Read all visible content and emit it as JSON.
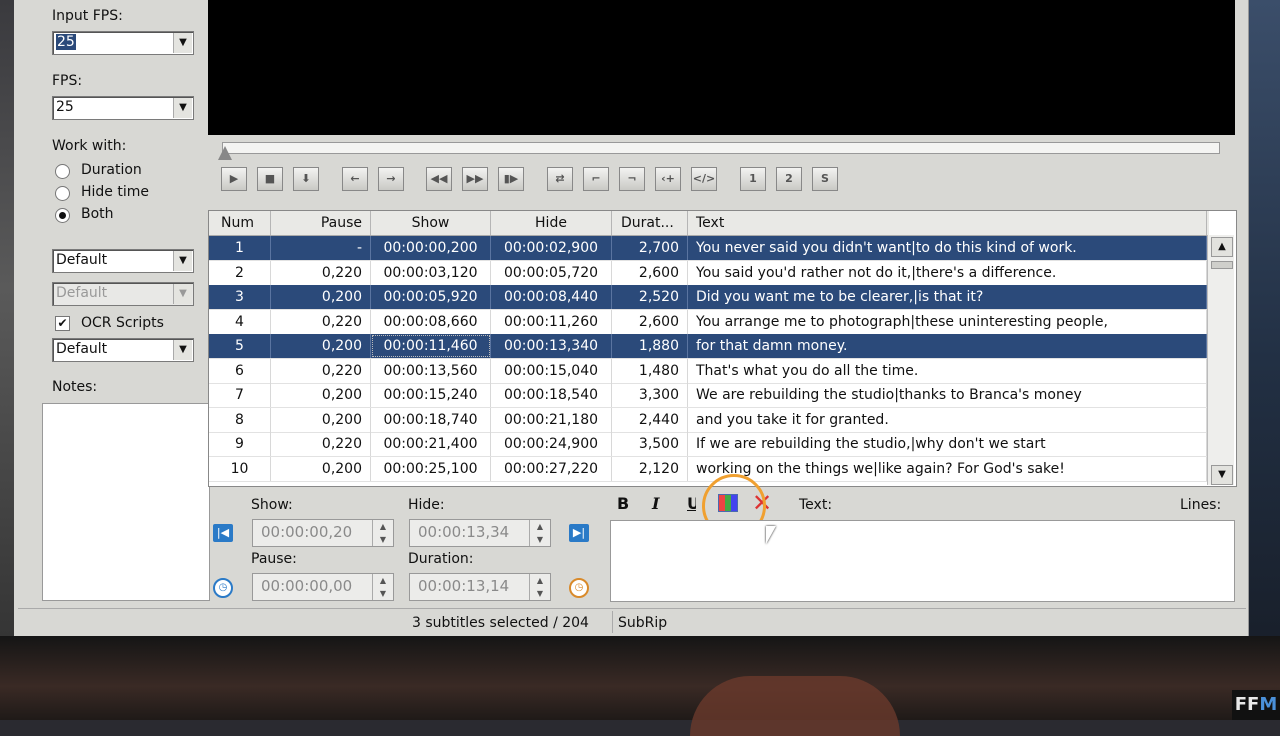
{
  "left_panel": {
    "input_fps_label": "Input FPS:",
    "input_fps_value": "25",
    "fps_label": "FPS:",
    "fps_value": "25",
    "work_with_label": "Work with:",
    "options": [
      "Duration",
      "Hide time",
      "Both"
    ],
    "selected_option": "Both",
    "style_combo": "Default",
    "style_combo_disabled": "Default",
    "ocr_label": "OCR Scripts",
    "ocr_checked": true,
    "ocr_combo": "Default",
    "notes_label": "Notes:"
  },
  "grid": {
    "columns": [
      "Num",
      "Pause",
      "Show",
      "Hide",
      "Durat...",
      "Text"
    ],
    "rows": [
      {
        "num": "1",
        "pause": "-",
        "show": "00:00:00,200",
        "hide": "00:00:02,900",
        "dur": "2,700",
        "text": "You never said you didn't want|to do this kind of work.",
        "selected": true
      },
      {
        "num": "2",
        "pause": "0,220",
        "show": "00:00:03,120",
        "hide": "00:00:05,720",
        "dur": "2,600",
        "text": "You said you'd rather not do it,|there's a difference.",
        "selected": false
      },
      {
        "num": "3",
        "pause": "0,200",
        "show": "00:00:05,920",
        "hide": "00:00:08,440",
        "dur": "2,520",
        "text": "Did you want me to be clearer,|is that it?",
        "selected": true
      },
      {
        "num": "4",
        "pause": "0,220",
        "show": "00:00:08,660",
        "hide": "00:00:11,260",
        "dur": "2,600",
        "text": "You arrange me to photograph|these uninteresting people,",
        "selected": false
      },
      {
        "num": "5",
        "pause": "0,200",
        "show": "00:00:11,460",
        "hide": "00:00:13,340",
        "dur": "1,880",
        "text": "for that damn money.",
        "selected": true
      },
      {
        "num": "6",
        "pause": "0,220",
        "show": "00:00:13,560",
        "hide": "00:00:15,040",
        "dur": "1,480",
        "text": "That's what you do all the time.",
        "selected": false
      },
      {
        "num": "7",
        "pause": "0,200",
        "show": "00:00:15,240",
        "hide": "00:00:18,540",
        "dur": "3,300",
        "text": "We are rebuilding the studio|thanks to Branca's money",
        "selected": false
      },
      {
        "num": "8",
        "pause": "0,200",
        "show": "00:00:18,740",
        "hide": "00:00:21,180",
        "dur": "2,440",
        "text": "and you take it for granted.",
        "selected": false
      },
      {
        "num": "9",
        "pause": "0,220",
        "show": "00:00:21,400",
        "hide": "00:00:24,900",
        "dur": "3,500",
        "text": "If we are rebuilding the studio,|why don't we start",
        "selected": false
      },
      {
        "num": "10",
        "pause": "0,200",
        "show": "00:00:25,100",
        "hide": "00:00:27,220",
        "dur": "2,120",
        "text": "working on the things we|like again? For God's sake!",
        "selected": false
      }
    ]
  },
  "editor": {
    "show_label": "Show:",
    "show_value": "00:00:00,20",
    "hide_label": "Hide:",
    "hide_value": "00:00:13,34",
    "pause_label": "Pause:",
    "pause_value": "00:00:00,00",
    "duration_label": "Duration:",
    "duration_value": "00:00:13,14",
    "bold": "B",
    "italic": "I",
    "underline": "U",
    "text_label": "Text:",
    "lines_label": "Lines:"
  },
  "toolbar": {
    "icons": [
      "play-icon",
      "stop-icon",
      "down-icon",
      "back-icon",
      "forward-icon",
      "rewind-icon",
      "fast-forward-icon",
      "step-icon",
      "swap-icon",
      "set-start-icon",
      "set-end-icon",
      "add-icon",
      "tag-icon",
      "one-icon",
      "two-icon",
      "s-icon"
    ]
  },
  "status": {
    "selection": "3 subtitles selected / 204",
    "format": "SubRip"
  },
  "watermark": {
    "a": "FF",
    "b": "M"
  },
  "colors": {
    "selection": "#2b4a7a",
    "accent": "#2a7ac7",
    "highlight_ring": "#f0a030"
  }
}
